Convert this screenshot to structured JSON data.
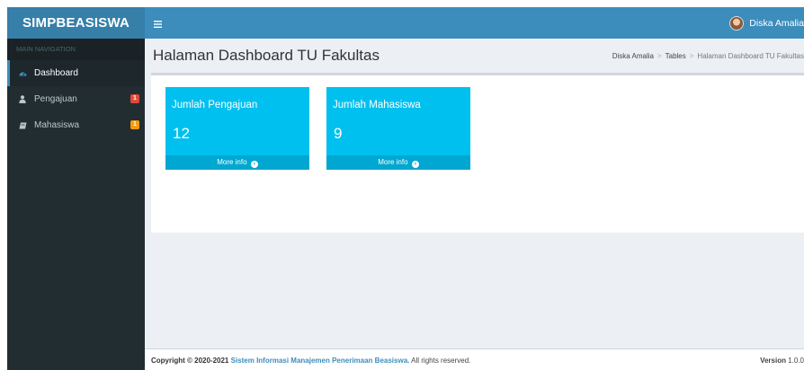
{
  "header": {
    "logo": "SIMPBEASISWA",
    "toggle_icon": "hamburger-icon",
    "user_name": "Diska Amalia"
  },
  "sidebar": {
    "section_label": "MAIN NAVIGATION",
    "items": [
      {
        "label": "Dashboard",
        "icon": "dashboard-icon",
        "active": true
      },
      {
        "label": "Pengajuan",
        "icon": "user-icon",
        "badge": "1",
        "badge_color": "#dd4b39"
      },
      {
        "label": "Mahasiswa",
        "icon": "book-icon",
        "badge": "1",
        "badge_color": "#f39c12"
      }
    ]
  },
  "content": {
    "title": "Halaman Dashboard TU Fakultas",
    "breadcrumb": [
      "Diska Amalia",
      "Tables",
      "Halaman Dashboard TU Fakultas"
    ]
  },
  "tiles": [
    {
      "title": "Jumlah Pengajuan",
      "value": "12",
      "link": "More info"
    },
    {
      "title": "Jumlah Mahasiswa",
      "value": "9",
      "link": "More info"
    }
  ],
  "footer": {
    "copyright": "Copyright © 2020-2021",
    "app_name": "Sistem Informasi Manajemen Penerimaan Beasiswa.",
    "rights": "All rights reserved.",
    "version_label": "Version",
    "version": "1.0.0"
  },
  "colors": {
    "header": "#3c8dbc",
    "logo_bg": "#367fa9",
    "sidebar": "#222d32",
    "tile": "#00c0ef",
    "tile_footer": "#00a7d0"
  }
}
